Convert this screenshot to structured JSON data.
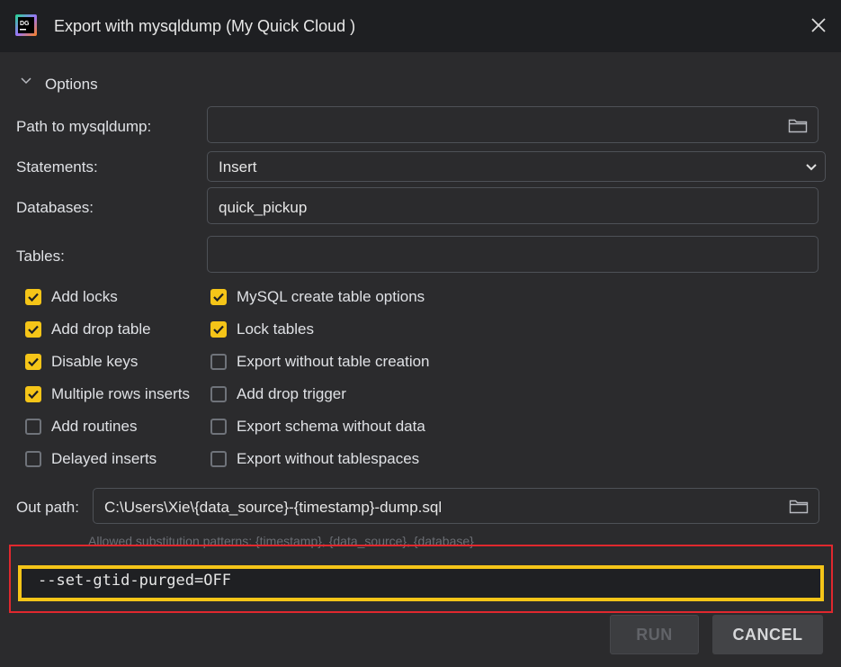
{
  "window": {
    "title": "Export with mysqldump (My Quick Cloud )",
    "app_icon_text": "DG"
  },
  "options": {
    "section_label": "Options",
    "path_label": "Path to mysqldump:",
    "path_value": "",
    "statements_label": "Statements:",
    "statements_value": "Insert",
    "databases_label": "Databases:",
    "databases_value": "quick_pickup",
    "tables_label": "Tables:",
    "tables_value": ""
  },
  "checkboxes_left": [
    {
      "label": "Add locks",
      "checked": true
    },
    {
      "label": "Add drop table",
      "checked": true
    },
    {
      "label": "Disable keys",
      "checked": true
    },
    {
      "label": "Multiple rows inserts",
      "checked": true
    },
    {
      "label": "Add routines",
      "checked": false
    },
    {
      "label": "Delayed inserts",
      "checked": false
    }
  ],
  "checkboxes_right": [
    {
      "label": "MySQL create table options",
      "checked": true
    },
    {
      "label": "Lock tables",
      "checked": true
    },
    {
      "label": "Export without table creation",
      "checked": false
    },
    {
      "label": "Add drop trigger",
      "checked": false
    },
    {
      "label": "Export schema without data",
      "checked": false
    },
    {
      "label": "Export without tablespaces",
      "checked": false
    }
  ],
  "out_path": {
    "label": "Out path:",
    "value": "C:\\Users\\Xie\\{data_source}-{timestamp}-dump.sql",
    "hint": "Allowed substitution patterns: {timestamp}, {data_source}, {database}"
  },
  "command_line": {
    "value": "--set-gtid-purged=OFF"
  },
  "buttons": {
    "run_label": "RUN",
    "cancel_label": "CANCEL"
  },
  "colors": {
    "accent_checkbox": "#f5c518",
    "highlight_red": "#e0282e",
    "highlight_yellow": "#f5c518",
    "background": "#2b2b2d",
    "titlebar": "#1e1f22"
  }
}
